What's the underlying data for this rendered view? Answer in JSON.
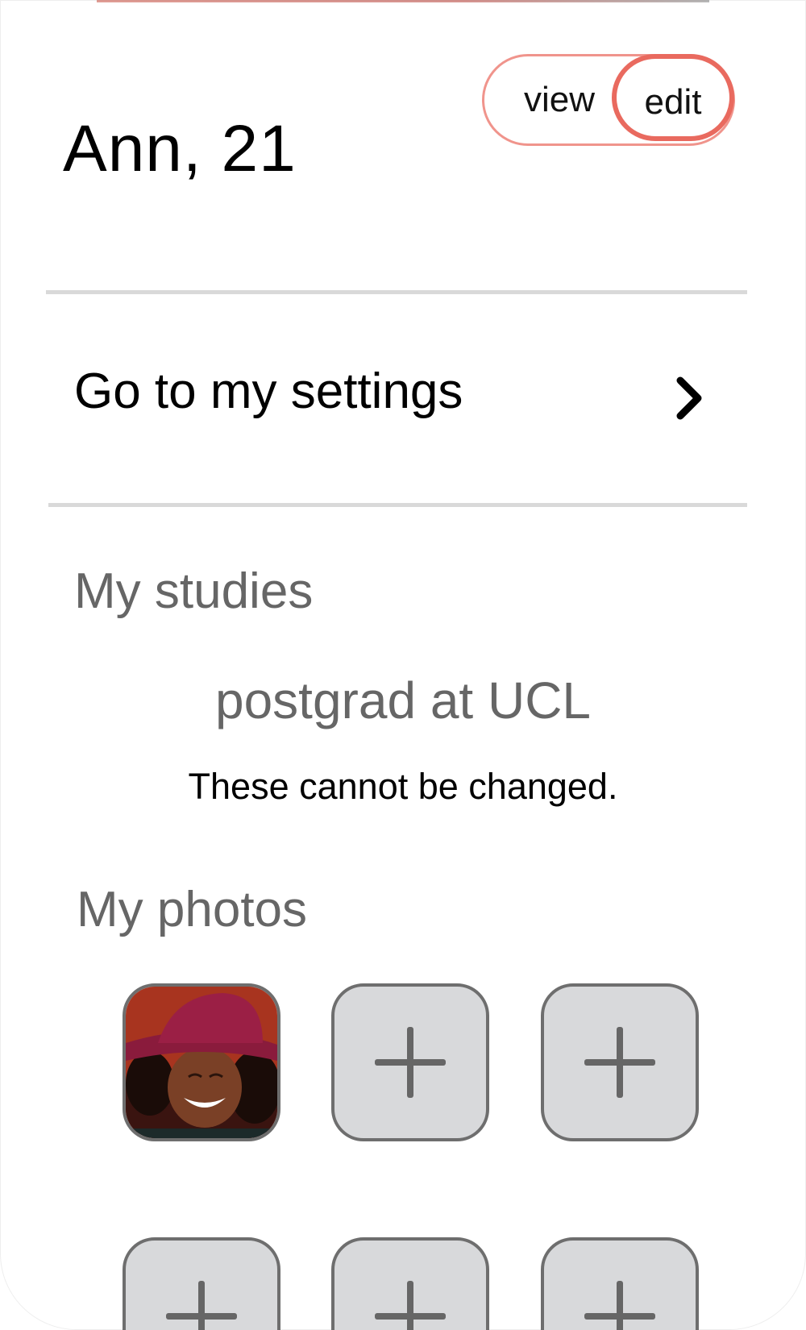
{
  "profile": {
    "name_age": "Ann, 21"
  },
  "mode_toggle": {
    "view_label": "view",
    "edit_label": "edit",
    "selected": "edit",
    "accent_color": "#e96a5f"
  },
  "settings_link": {
    "label": "Go to my settings",
    "icon": "chevron-right-icon"
  },
  "studies": {
    "heading": "My studies",
    "value": "postgrad at UCL",
    "note": "These cannot be changed."
  },
  "photos": {
    "heading": "My photos",
    "slots": [
      {
        "type": "photo",
        "description_icon": "profile-photo"
      },
      {
        "type": "add",
        "icon": "plus-icon"
      },
      {
        "type": "add",
        "icon": "plus-icon"
      },
      {
        "type": "add",
        "icon": "plus-icon"
      },
      {
        "type": "add",
        "icon": "plus-icon"
      },
      {
        "type": "add",
        "icon": "plus-icon"
      }
    ]
  }
}
